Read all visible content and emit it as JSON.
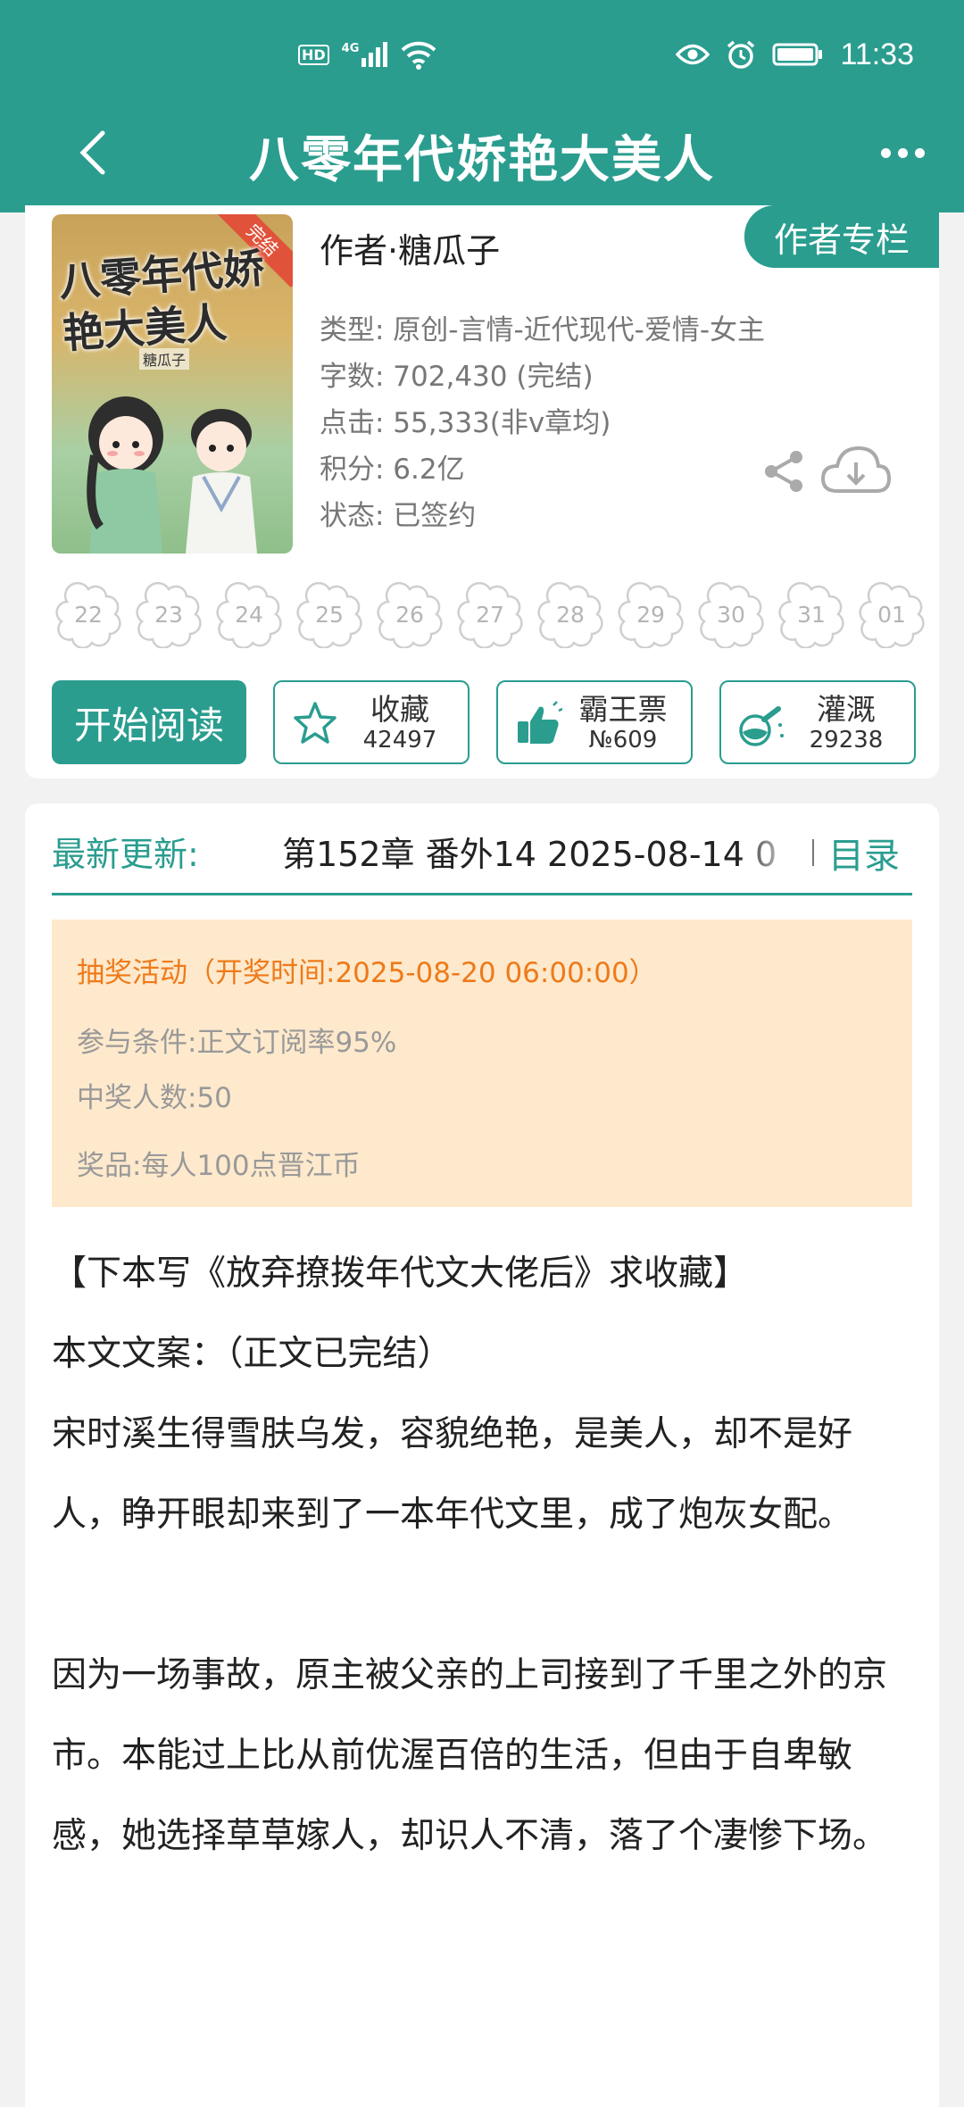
{
  "status_bar": {
    "network": "HD",
    "signal": "4G",
    "time": "11:33"
  },
  "header": {
    "title": "八零年代娇艳大美人",
    "back_icon": "chevron-left-icon",
    "more_icon": "more-dots-icon"
  },
  "book": {
    "cover_title": "八零年代娇艳大美人",
    "cover_author": "糖瓜子",
    "cover_badge": "完结",
    "author_line": "作者·糖瓜子",
    "author_column_label": "作者专栏",
    "meta": [
      "类型: 原创-言情-近代现代-爱情-女主",
      "字数: 702,430 (完结)",
      "点击: 55,333(非v章均)",
      "积分: 6.2亿",
      "状态: 已签约"
    ],
    "flower_days": [
      "22",
      "23",
      "24",
      "25",
      "26",
      "27",
      "28",
      "29",
      "30",
      "31",
      "01"
    ]
  },
  "actions": {
    "read_label": "开始阅读",
    "favorite": {
      "label": "收藏",
      "value": "42497",
      "icon": "star-icon"
    },
    "bawang": {
      "label": "霸王票",
      "value": "№609",
      "icon": "thumbs-up-icon"
    },
    "irrigate": {
      "label": "灌溉",
      "value": "29238",
      "icon": "flask-icon"
    }
  },
  "latest": {
    "label": "最新更新:",
    "chapter": "第152章  番外14  2025-08-14 0",
    "toc_label": "目录"
  },
  "lottery": {
    "title": "抽奖活动（开奖时间:2025-08-20 06:00:00）",
    "condition": "参与条件:正文订阅率95%",
    "winners": "中奖人数:50",
    "prize": "奖品:每人100点晋江币"
  },
  "synopsis": {
    "recommend": "【下本写《放弃撩拨年代文大佬后》求收藏】",
    "heading": "本文文案：（正文已完结）",
    "para1": "宋时溪生得雪肤乌发，容貌绝艳，是美人，却不是好人，睁开眼却来到了一本年代文里，成了炮灰女配。",
    "para2": "因为一场事故，原主被父亲的上司接到了千里之外的京市。本能过上比从前优渥百倍的生活，但由于自卑敏感，她选择草草嫁人，却识人不清，落了个凄惨下场。"
  },
  "colors": {
    "primary": "#2a9d8f",
    "lottery_bg": "#fee9cc",
    "lottery_title": "#ee7a1a"
  }
}
